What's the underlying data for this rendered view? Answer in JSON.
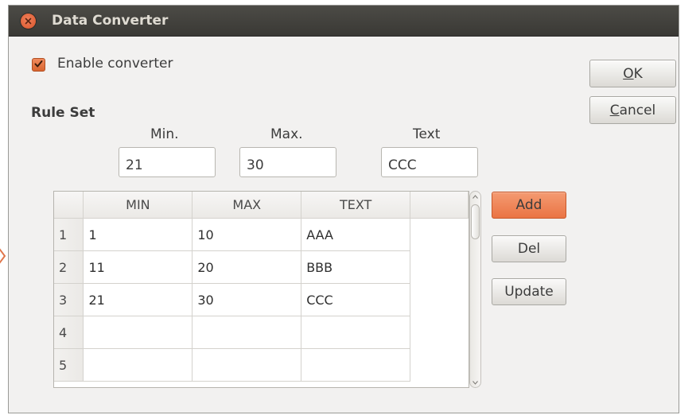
{
  "window": {
    "title": "Data Converter"
  },
  "enable": {
    "label": "Enable converter",
    "checked": true
  },
  "buttons": {
    "ok": "OK",
    "cancel": "Cancel",
    "add": "Add",
    "del": "Del",
    "update": "Update"
  },
  "rule_set": {
    "heading": "Rule Set",
    "labels": {
      "min": "Min.",
      "max": "Max.",
      "text": "Text"
    },
    "values": {
      "min": "21",
      "max": "30",
      "text": "CCC"
    }
  },
  "table": {
    "columns": [
      "MIN",
      "MAX",
      "TEXT"
    ],
    "rows": [
      {
        "num": "1",
        "min": "1",
        "max": "10",
        "text": "AAA"
      },
      {
        "num": "2",
        "min": "11",
        "max": "20",
        "text": "BBB"
      },
      {
        "num": "3",
        "min": "21",
        "max": "30",
        "text": "CCC"
      },
      {
        "num": "4",
        "min": "",
        "max": "",
        "text": ""
      },
      {
        "num": "5",
        "min": "",
        "max": "",
        "text": ""
      }
    ]
  },
  "colors": {
    "accent": "#ea7444",
    "titlebar": "#3c3b37",
    "window_bg": "#f2f1f0"
  }
}
